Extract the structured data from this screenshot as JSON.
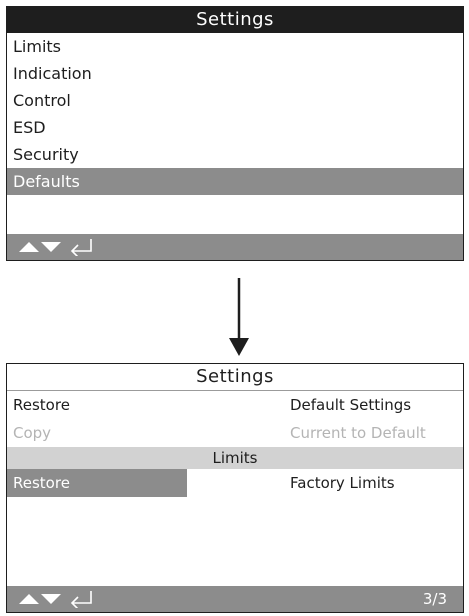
{
  "screen1": {
    "title": "Settings",
    "menu": [
      {
        "label": "Limits"
      },
      {
        "label": "Indication"
      },
      {
        "label": "Control"
      },
      {
        "label": "ESD"
      },
      {
        "label": "Security"
      },
      {
        "label": "Defaults"
      }
    ],
    "selected_index": 5
  },
  "screen2": {
    "title": "Settings",
    "rows": [
      {
        "left": "Restore",
        "right": "Default Settings"
      },
      {
        "left": "Copy",
        "right": "Current to Default"
      }
    ],
    "section_header": "Limits",
    "limits_row": {
      "left": "Restore",
      "right": "Factory Limits"
    },
    "page_indicator": "3/3"
  },
  "icons": {
    "nav_up": "up-triangle-icon",
    "nav_down": "down-triangle-icon",
    "nav_enter": "enter-arrow-icon",
    "flow_arrow": "down-arrow-icon"
  },
  "colors": {
    "dark": "#1e1e1e",
    "highlight": "#8c8c8c",
    "disabled_text": "#b4b4b4",
    "section_bg": "#d2d2d2"
  }
}
